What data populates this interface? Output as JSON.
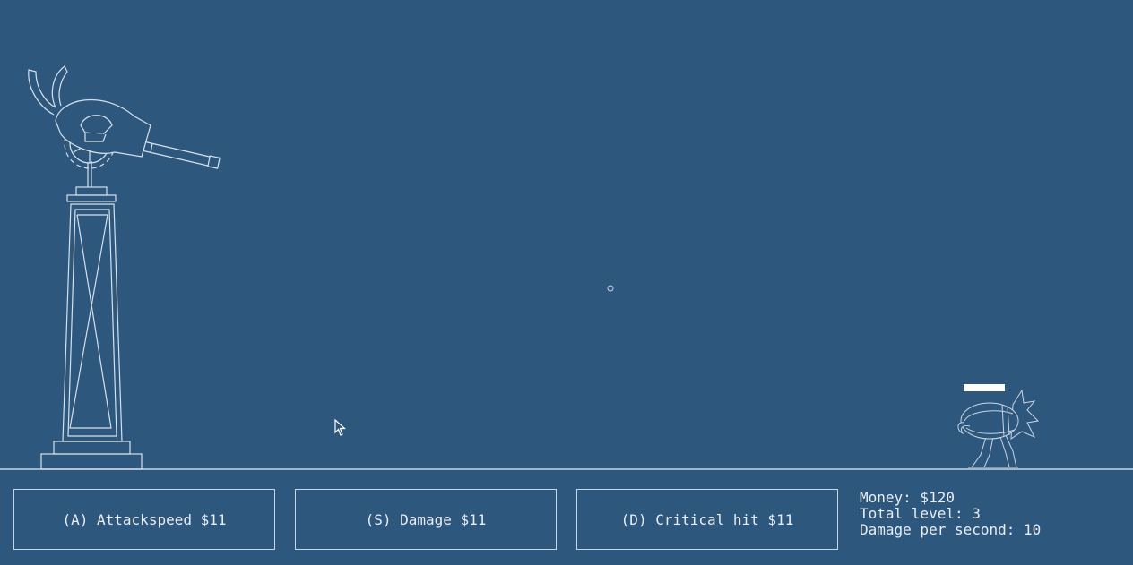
{
  "upgrades": [
    {
      "key": "A",
      "label": "(A) Attackspeed $11"
    },
    {
      "key": "S",
      "label": "(S) Damage $11"
    },
    {
      "key": "D",
      "label": "(D) Critical hit $11"
    }
  ],
  "stats": {
    "money": "Money: $120",
    "total_level": "Total level: 3",
    "dps": "Damage per second: 10"
  },
  "enemy": {
    "health_fraction": 1.0
  },
  "colors": {
    "background": "#2e577e",
    "line": "#c7d6e4",
    "text": "#e8eef4"
  }
}
